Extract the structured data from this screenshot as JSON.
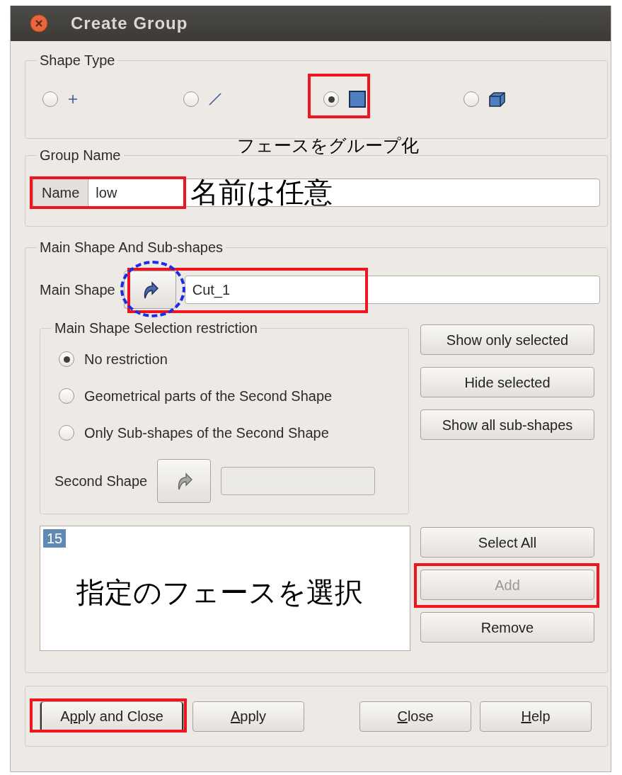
{
  "window": {
    "title": "Create Group"
  },
  "shape_type": {
    "title": "Shape Type",
    "options": [
      {
        "kind": "vertex",
        "selected": false
      },
      {
        "kind": "edge",
        "selected": false
      },
      {
        "kind": "face",
        "selected": true,
        "highlighted": true
      },
      {
        "kind": "solid",
        "selected": false
      }
    ]
  },
  "group_name": {
    "title": "Group Name",
    "label": "Name",
    "value": "low",
    "highlighted": true
  },
  "main_shape": {
    "title": "Main Shape And Sub-shapes",
    "label": "Main Shape",
    "value": "Cut_1",
    "highlighted": true,
    "button_circled": true,
    "restriction": {
      "title": "Main Shape Selection restriction",
      "options": [
        {
          "label": "No restriction",
          "selected": true
        },
        {
          "label": "Geometrical parts of the Second Shape",
          "selected": false
        },
        {
          "label": "Only Sub-shapes of the Second Shape",
          "selected": false
        }
      ],
      "second_shape_label": "Second Shape",
      "second_shape_disabled": true
    },
    "side_buttons": [
      {
        "label": "Show only selected",
        "disabled": false
      },
      {
        "label": "Hide selected",
        "disabled": false
      },
      {
        "label": "Show all sub-shapes",
        "disabled": false
      }
    ],
    "ids": [
      {
        "label": "15",
        "selected": true
      }
    ],
    "list_buttons": [
      {
        "label": "Select All",
        "disabled": false
      },
      {
        "label": "Add",
        "disabled": true,
        "highlighted": true
      },
      {
        "label": "Remove",
        "disabled": false
      }
    ]
  },
  "buttons": [
    {
      "before": "A",
      "key": "p",
      "after": "ply and Close",
      "focused": true,
      "highlighted": true
    },
    {
      "key": "A",
      "after": "pply",
      "focused": false
    },
    {
      "key": "C",
      "after": "lose",
      "focused": false
    },
    {
      "key": "H",
      "after": "elp",
      "focused": false
    }
  ],
  "annotations": [
    {
      "kind": "shape_note",
      "text": "フェースをグループ化"
    },
    {
      "kind": "name_note",
      "text": "名前は任意"
    },
    {
      "kind": "list_note",
      "text": "指定のフェースを選択"
    }
  ]
}
